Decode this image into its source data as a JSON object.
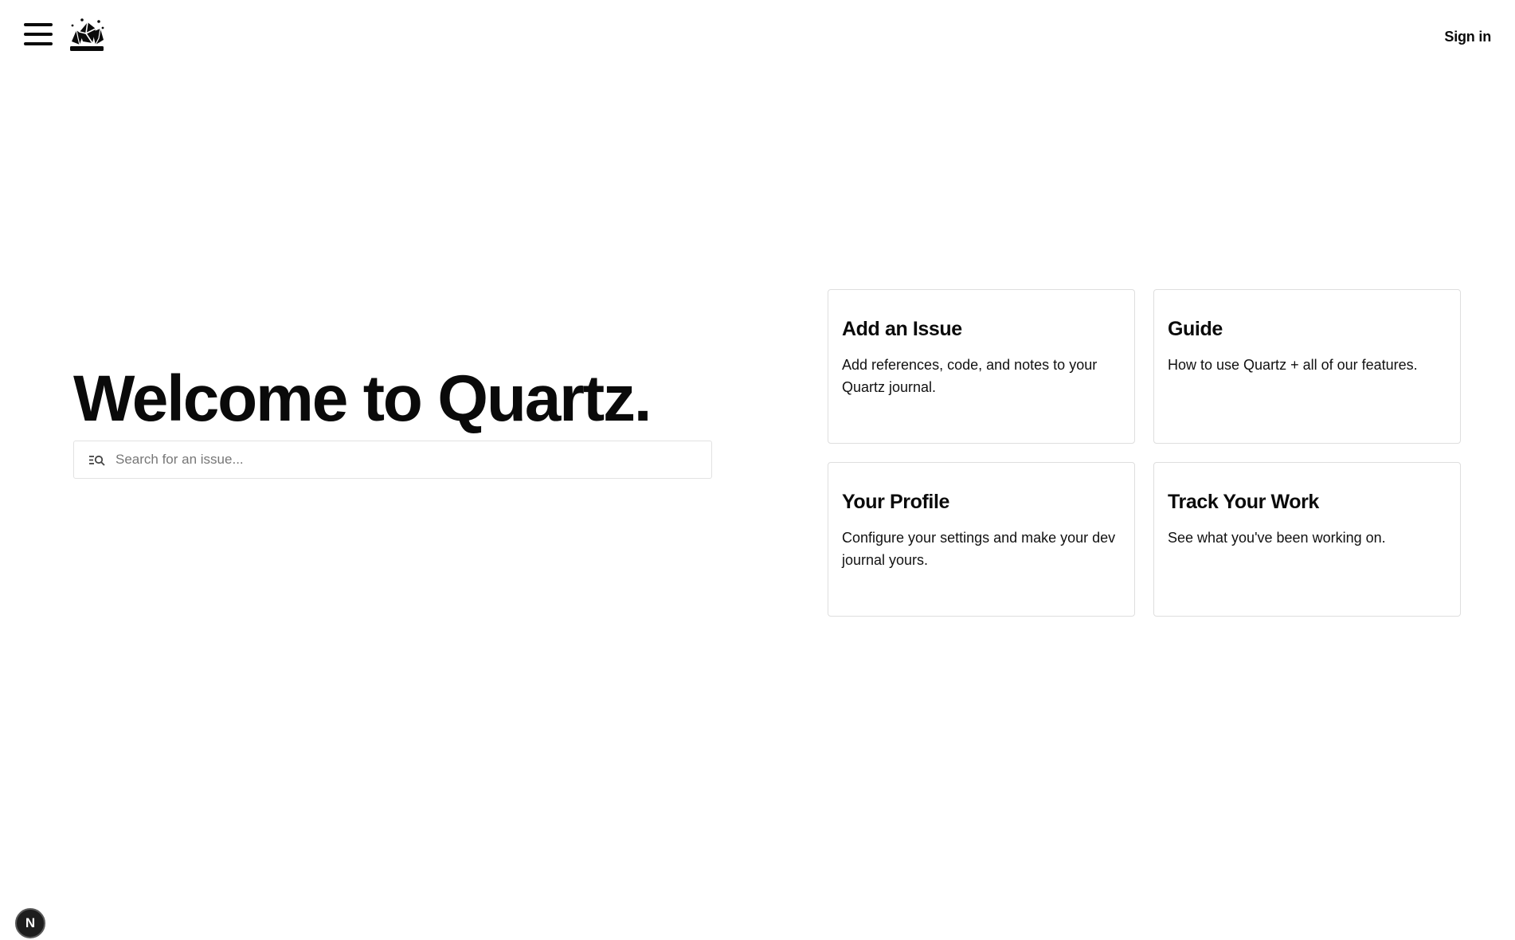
{
  "header": {
    "menu_icon": "hamburger-menu-icon",
    "logo_icon": "quartz-crystal-logo-icon",
    "signin_label": "Sign in"
  },
  "hero": {
    "title": "Welcome to Quartz.",
    "search": {
      "icon": "search-list-icon",
      "placeholder": "Search for an issue..."
    }
  },
  "cards": [
    {
      "title": "Add an Issue",
      "description": "Add references, code, and notes to your Quartz journal."
    },
    {
      "title": "Guide",
      "description": "How to use Quartz + all of our features."
    },
    {
      "title": "Your Profile",
      "description": "Configure your settings and make your dev journal yours."
    },
    {
      "title": "Track Your Work",
      "description": "See what you've been working on."
    }
  ],
  "dev_badge": {
    "label": "N",
    "icon": "nextjs-dev-indicator-icon"
  }
}
